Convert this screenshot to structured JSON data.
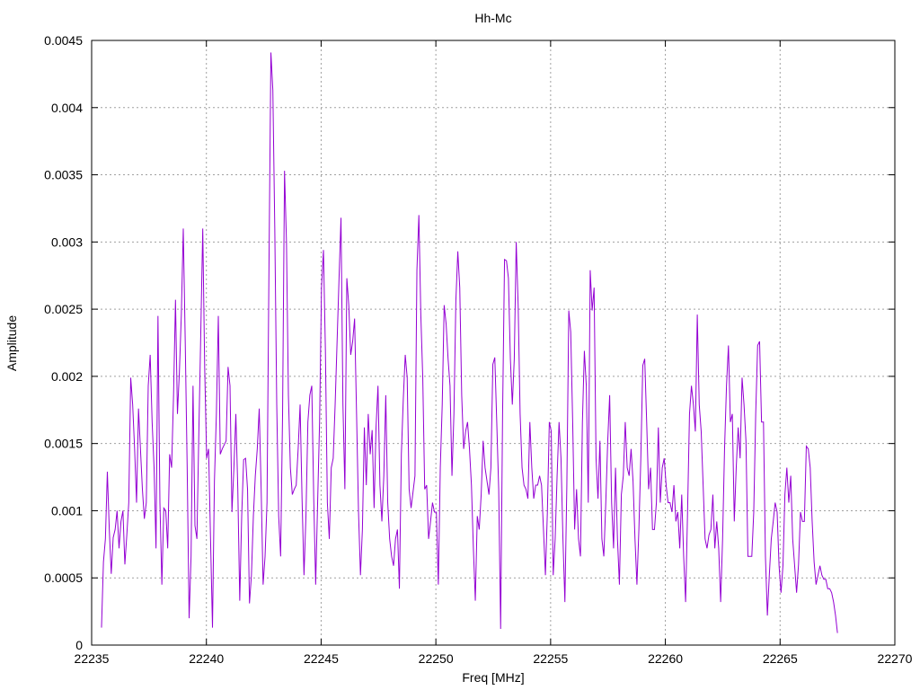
{
  "chart_data": {
    "type": "line",
    "title": "Hh-Mc",
    "xlabel": "Freq [MHz]",
    "ylabel": "Amplitude",
    "xlim": [
      22235,
      22270
    ],
    "ylim": [
      0,
      0.0045
    ],
    "grid": true,
    "xticks": [
      "22235",
      "22240",
      "22245",
      "22250",
      "22255",
      "22260",
      "22265",
      "22270"
    ],
    "yticks": [
      "0",
      "0.0005",
      "0.001",
      "0.0015",
      "0.002",
      "0.0025",
      "0.003",
      "0.0035",
      "0.004",
      "0.0045"
    ],
    "series": [
      {
        "name": "Hh-Mc",
        "color": "#9400d3",
        "freq_range": [
          22235.43,
          22267.5
        ],
        "values": [
          0.00013,
          0.00062,
          0.00079,
          0.00129,
          0.00086,
          0.00053,
          0.0008,
          0.00086,
          0.001,
          0.00072,
          0.00092,
          0.001,
          0.0006,
          0.00082,
          0.00106,
          0.00199,
          0.00179,
          0.00146,
          0.00106,
          0.00176,
          0.00146,
          0.00116,
          0.00094,
          0.00106,
          0.00193,
          0.00216,
          0.00166,
          0.00132,
          0.00072,
          0.00245,
          0.00106,
          0.00045,
          0.00102,
          0.001,
          0.00072,
          0.00142,
          0.00132,
          0.00186,
          0.00257,
          0.00172,
          0.00203,
          0.00246,
          0.0031,
          0.00226,
          0.00132,
          0.0002,
          0.00066,
          0.00193,
          0.00089,
          0.00079,
          0.00159,
          0.00233,
          0.0031,
          0.00206,
          0.00139,
          0.00146,
          0.00079,
          0.00013,
          0.00122,
          0.00172,
          0.00245,
          0.00142,
          0.00146,
          0.00149,
          0.00152,
          0.00207,
          0.00193,
          0.00099,
          0.00132,
          0.00172,
          0.00116,
          0.00033,
          0.00096,
          0.00138,
          0.00139,
          0.00116,
          0.00031,
          0.00052,
          0.00096,
          0.00126,
          0.00146,
          0.00176,
          0.00116,
          0.00045,
          0.00066,
          0.00106,
          0.00279,
          0.00441,
          0.00413,
          0.0031,
          0.00179,
          0.00096,
          0.00066,
          0.00172,
          0.00353,
          0.003,
          0.00186,
          0.00132,
          0.00112,
          0.00116,
          0.00119,
          0.00146,
          0.00179,
          0.00109,
          0.00052,
          0.00096,
          0.00166,
          0.00186,
          0.00193,
          0.00109,
          0.00045,
          0.00106,
          0.00166,
          0.00266,
          0.00294,
          0.00219,
          0.00106,
          0.00079,
          0.00132,
          0.00139,
          0.00179,
          0.00226,
          0.00273,
          0.00318,
          0.00179,
          0.00116,
          0.00273,
          0.00253,
          0.00216,
          0.00226,
          0.00243,
          0.00172,
          0.00099,
          0.00052,
          0.00086,
          0.00162,
          0.00119,
          0.00172,
          0.00142,
          0.0016,
          0.00102,
          0.00162,
          0.00193,
          0.00119,
          0.00092,
          0.00126,
          0.00186,
          0.00106,
          0.00079,
          0.00066,
          0.00059,
          0.00079,
          0.00086,
          0.00042,
          0.00142,
          0.00183,
          0.00216,
          0.00199,
          0.00116,
          0.00102,
          0.00114,
          0.00126,
          0.00279,
          0.0032,
          0.00246,
          0.00199,
          0.00116,
          0.00119,
          0.00079,
          0.00092,
          0.00106,
          0.00099,
          0.00099,
          0.00045,
          0.00132,
          0.00179,
          0.00253,
          0.00239,
          0.00213,
          0.00193,
          0.00126,
          0.00172,
          0.00256,
          0.00293,
          0.00266,
          0.00186,
          0.00146,
          0.00159,
          0.00166,
          0.00146,
          0.00119,
          0.00072,
          0.00033,
          0.00096,
          0.00086,
          0.00112,
          0.00152,
          0.00132,
          0.00122,
          0.00112,
          0.00132,
          0.00209,
          0.00214,
          0.00166,
          0.00116,
          0.00012,
          0.00172,
          0.00287,
          0.00286,
          0.00273,
          0.00213,
          0.00179,
          0.00213,
          0.003,
          0.00253,
          0.00172,
          0.00132,
          0.00119,
          0.00116,
          0.00109,
          0.00166,
          0.00132,
          0.00109,
          0.00119,
          0.00119,
          0.00126,
          0.00119,
          0.00086,
          0.00052,
          0.00099,
          0.00166,
          0.00159,
          0.00052,
          0.00079,
          0.00126,
          0.00166,
          0.00139,
          0.00079,
          0.00032,
          0.00119,
          0.00249,
          0.00233,
          0.00166,
          0.00086,
          0.00116,
          0.00079,
          0.00066,
          0.00166,
          0.00219,
          0.00193,
          0.00106,
          0.00279,
          0.00249,
          0.00266,
          0.00139,
          0.00109,
          0.00152,
          0.00079,
          0.00066,
          0.00106,
          0.00152,
          0.00186,
          0.00106,
          0.00072,
          0.00132,
          0.00079,
          0.00045,
          0.00112,
          0.00126,
          0.00166,
          0.00132,
          0.00126,
          0.00146,
          0.00122,
          0.00079,
          0.00045,
          0.00086,
          0.00139,
          0.00208,
          0.00213,
          0.00166,
          0.00116,
          0.00132,
          0.00086,
          0.00086,
          0.00106,
          0.00162,
          0.00106,
          0.00132,
          0.00139,
          0.00119,
          0.00106,
          0.00106,
          0.00099,
          0.00119,
          0.00092,
          0.00099,
          0.00072,
          0.00112,
          0.00066,
          0.00032,
          0.00099,
          0.00172,
          0.00193,
          0.00179,
          0.00159,
          0.00246,
          0.00179,
          0.00159,
          0.00119,
          0.00079,
          0.00072,
          0.00082,
          0.00086,
          0.00112,
          0.00072,
          0.00092,
          0.00072,
          0.00032,
          0.00079,
          0.00146,
          0.00193,
          0.00223,
          0.00166,
          0.00172,
          0.00092,
          0.00132,
          0.00162,
          0.00139,
          0.00199,
          0.00179,
          0.00152,
          0.00066,
          0.00066,
          0.00066,
          0.00099,
          0.00172,
          0.00223,
          0.00226,
          0.00166,
          0.00166,
          0.00066,
          0.00022,
          0.00052,
          0.00079,
          0.00092,
          0.00106,
          0.00099,
          0.00059,
          0.00039,
          0.00059,
          0.00112,
          0.00132,
          0.00106,
          0.00126,
          0.00079,
          0.00059,
          0.00039,
          0.0006,
          0.00099,
          0.00092,
          0.00092,
          0.00148,
          0.00146,
          0.00132,
          0.00092,
          0.00062,
          0.00045,
          0.00052,
          0.00059,
          0.00052,
          0.00049,
          0.00049,
          0.00042,
          0.00042,
          0.00039,
          0.00032,
          0.00022,
          9e-05
        ]
      }
    ]
  }
}
